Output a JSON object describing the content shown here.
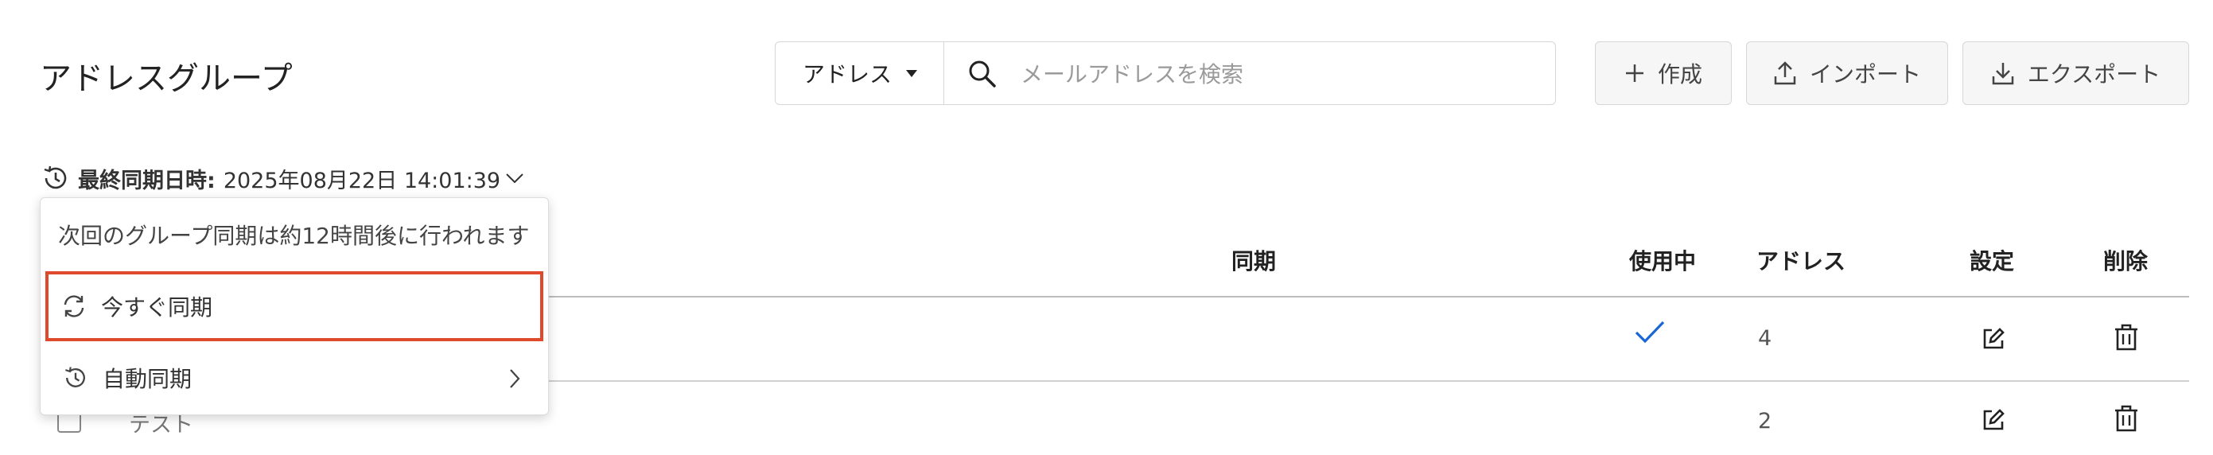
{
  "header": {
    "title": "アドレスグループ",
    "search": {
      "scope_label": "アドレス",
      "placeholder": "メールアドレスを検索",
      "value": ""
    },
    "buttons": {
      "create": "作成",
      "import": "インポート",
      "export": "エクスポート"
    }
  },
  "last_sync": {
    "label": "最終同期日時:",
    "value": "2025年08月22日 14:01:39"
  },
  "dropdown": {
    "info": "次回のグループ同期は約12時間後に行われます",
    "sync_now": "今すぐ同期",
    "auto_sync": "自動同期"
  },
  "table": {
    "columns": {
      "sync": "同期",
      "in_use": "使用中",
      "address": "アドレス",
      "settings": "設定",
      "delete": "削除"
    },
    "rows": [
      {
        "name": "",
        "in_use": true,
        "address_count": "4"
      },
      {
        "name": "テスト",
        "in_use": false,
        "address_count": "2"
      }
    ]
  },
  "colors": {
    "accent": "#1a66d6",
    "highlight_border": "#e04a2c",
    "border": "#d6d6d6"
  },
  "icons": [
    "search-icon",
    "plus-icon",
    "upload-icon",
    "download-icon",
    "history-icon",
    "chevron-down-icon",
    "refresh-icon",
    "chevron-right-icon",
    "check-icon",
    "edit-icon",
    "trash-icon"
  ]
}
